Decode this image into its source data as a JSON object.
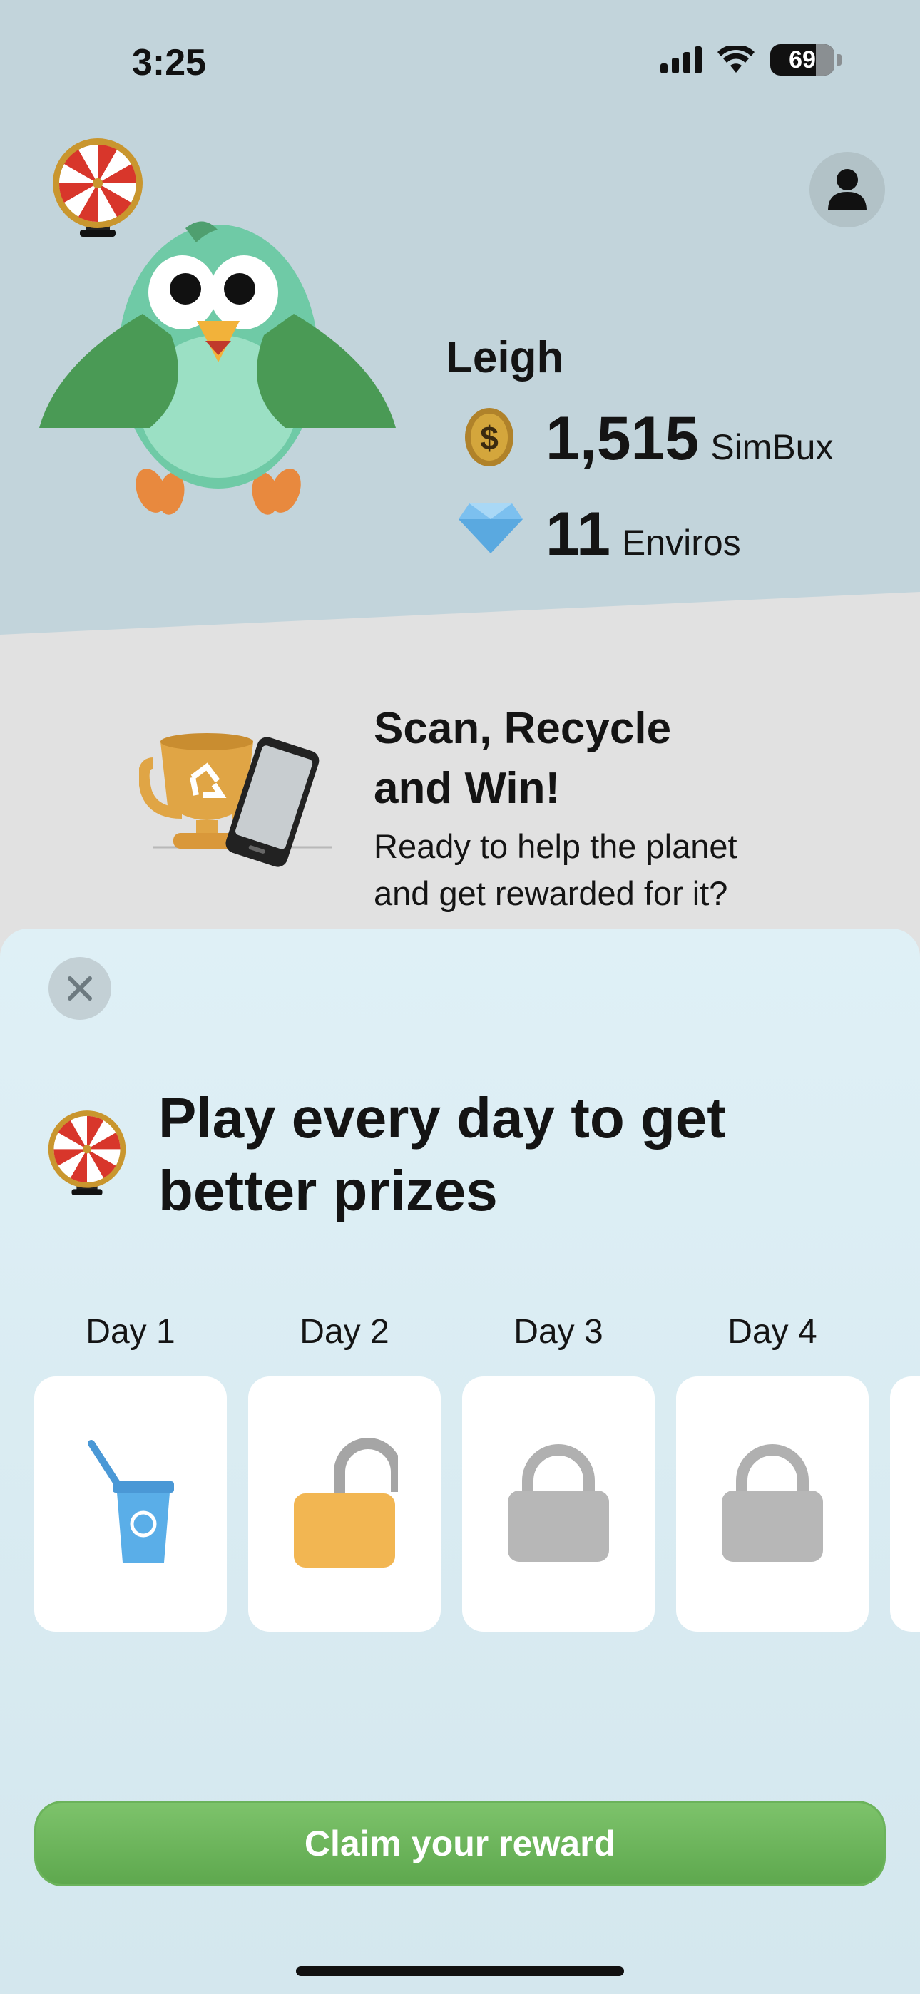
{
  "status_bar": {
    "time": "3:25",
    "battery": "69"
  },
  "profile": {
    "name": "Leigh",
    "simbux_value": "1,515",
    "simbux_label": "SimBux",
    "enviros_value": "11",
    "enviros_label": "Enviros"
  },
  "banner": {
    "title_line1": "Scan, Recycle",
    "title_line2": "and Win!",
    "subtitle_line1": "Ready to help the planet",
    "subtitle_line2": "and get rewarded for it?"
  },
  "sheet": {
    "title_line1": "Play every day to get",
    "title_line2": "better prizes",
    "days": [
      {
        "label": "Day 1",
        "icon": "recycle-bin-icon"
      },
      {
        "label": "Day 2",
        "icon": "unlocked-padlock-icon"
      },
      {
        "label": "Day 3",
        "icon": "locked-padlock-icon"
      },
      {
        "label": "Day 4",
        "icon": "locked-padlock-icon"
      }
    ],
    "claim_label": "Claim your reward"
  },
  "colors": {
    "accent_green": "#6bb35b",
    "header_bg": "#c2d4db",
    "sheet_bg": "#dbedf3"
  }
}
